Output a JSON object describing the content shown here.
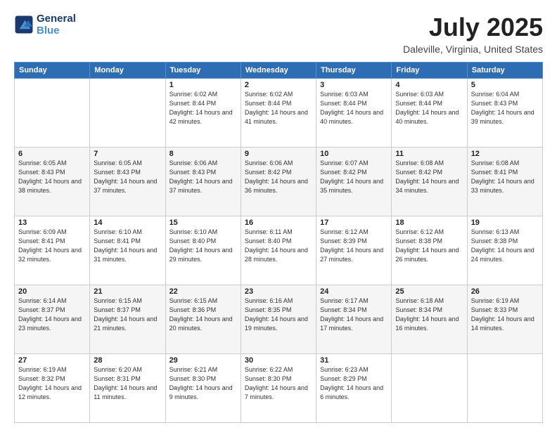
{
  "logo": {
    "line1": "General",
    "line2": "Blue"
  },
  "title": "July 2025",
  "subtitle": "Daleville, Virginia, United States",
  "weekdays": [
    "Sunday",
    "Monday",
    "Tuesday",
    "Wednesday",
    "Thursday",
    "Friday",
    "Saturday"
  ],
  "weeks": [
    [
      {
        "day": "",
        "info": ""
      },
      {
        "day": "",
        "info": ""
      },
      {
        "day": "1",
        "info": "Sunrise: 6:02 AM\nSunset: 8:44 PM\nDaylight: 14 hours and 42 minutes."
      },
      {
        "day": "2",
        "info": "Sunrise: 6:02 AM\nSunset: 8:44 PM\nDaylight: 14 hours and 41 minutes."
      },
      {
        "day": "3",
        "info": "Sunrise: 6:03 AM\nSunset: 8:44 PM\nDaylight: 14 hours and 40 minutes."
      },
      {
        "day": "4",
        "info": "Sunrise: 6:03 AM\nSunset: 8:44 PM\nDaylight: 14 hours and 40 minutes."
      },
      {
        "day": "5",
        "info": "Sunrise: 6:04 AM\nSunset: 8:43 PM\nDaylight: 14 hours and 39 minutes."
      }
    ],
    [
      {
        "day": "6",
        "info": "Sunrise: 6:05 AM\nSunset: 8:43 PM\nDaylight: 14 hours and 38 minutes."
      },
      {
        "day": "7",
        "info": "Sunrise: 6:05 AM\nSunset: 8:43 PM\nDaylight: 14 hours and 37 minutes."
      },
      {
        "day": "8",
        "info": "Sunrise: 6:06 AM\nSunset: 8:43 PM\nDaylight: 14 hours and 37 minutes."
      },
      {
        "day": "9",
        "info": "Sunrise: 6:06 AM\nSunset: 8:42 PM\nDaylight: 14 hours and 36 minutes."
      },
      {
        "day": "10",
        "info": "Sunrise: 6:07 AM\nSunset: 8:42 PM\nDaylight: 14 hours and 35 minutes."
      },
      {
        "day": "11",
        "info": "Sunrise: 6:08 AM\nSunset: 8:42 PM\nDaylight: 14 hours and 34 minutes."
      },
      {
        "day": "12",
        "info": "Sunrise: 6:08 AM\nSunset: 8:41 PM\nDaylight: 14 hours and 33 minutes."
      }
    ],
    [
      {
        "day": "13",
        "info": "Sunrise: 6:09 AM\nSunset: 8:41 PM\nDaylight: 14 hours and 32 minutes."
      },
      {
        "day": "14",
        "info": "Sunrise: 6:10 AM\nSunset: 8:41 PM\nDaylight: 14 hours and 31 minutes."
      },
      {
        "day": "15",
        "info": "Sunrise: 6:10 AM\nSunset: 8:40 PM\nDaylight: 14 hours and 29 minutes."
      },
      {
        "day": "16",
        "info": "Sunrise: 6:11 AM\nSunset: 8:40 PM\nDaylight: 14 hours and 28 minutes."
      },
      {
        "day": "17",
        "info": "Sunrise: 6:12 AM\nSunset: 8:39 PM\nDaylight: 14 hours and 27 minutes."
      },
      {
        "day": "18",
        "info": "Sunrise: 6:12 AM\nSunset: 8:38 PM\nDaylight: 14 hours and 26 minutes."
      },
      {
        "day": "19",
        "info": "Sunrise: 6:13 AM\nSunset: 8:38 PM\nDaylight: 14 hours and 24 minutes."
      }
    ],
    [
      {
        "day": "20",
        "info": "Sunrise: 6:14 AM\nSunset: 8:37 PM\nDaylight: 14 hours and 23 minutes."
      },
      {
        "day": "21",
        "info": "Sunrise: 6:15 AM\nSunset: 8:37 PM\nDaylight: 14 hours and 21 minutes."
      },
      {
        "day": "22",
        "info": "Sunrise: 6:15 AM\nSunset: 8:36 PM\nDaylight: 14 hours and 20 minutes."
      },
      {
        "day": "23",
        "info": "Sunrise: 6:16 AM\nSunset: 8:35 PM\nDaylight: 14 hours and 19 minutes."
      },
      {
        "day": "24",
        "info": "Sunrise: 6:17 AM\nSunset: 8:34 PM\nDaylight: 14 hours and 17 minutes."
      },
      {
        "day": "25",
        "info": "Sunrise: 6:18 AM\nSunset: 8:34 PM\nDaylight: 14 hours and 16 minutes."
      },
      {
        "day": "26",
        "info": "Sunrise: 6:19 AM\nSunset: 8:33 PM\nDaylight: 14 hours and 14 minutes."
      }
    ],
    [
      {
        "day": "27",
        "info": "Sunrise: 6:19 AM\nSunset: 8:32 PM\nDaylight: 14 hours and 12 minutes."
      },
      {
        "day": "28",
        "info": "Sunrise: 6:20 AM\nSunset: 8:31 PM\nDaylight: 14 hours and 11 minutes."
      },
      {
        "day": "29",
        "info": "Sunrise: 6:21 AM\nSunset: 8:30 PM\nDaylight: 14 hours and 9 minutes."
      },
      {
        "day": "30",
        "info": "Sunrise: 6:22 AM\nSunset: 8:30 PM\nDaylight: 14 hours and 7 minutes."
      },
      {
        "day": "31",
        "info": "Sunrise: 6:23 AM\nSunset: 8:29 PM\nDaylight: 14 hours and 6 minutes."
      },
      {
        "day": "",
        "info": ""
      },
      {
        "day": "",
        "info": ""
      }
    ]
  ]
}
